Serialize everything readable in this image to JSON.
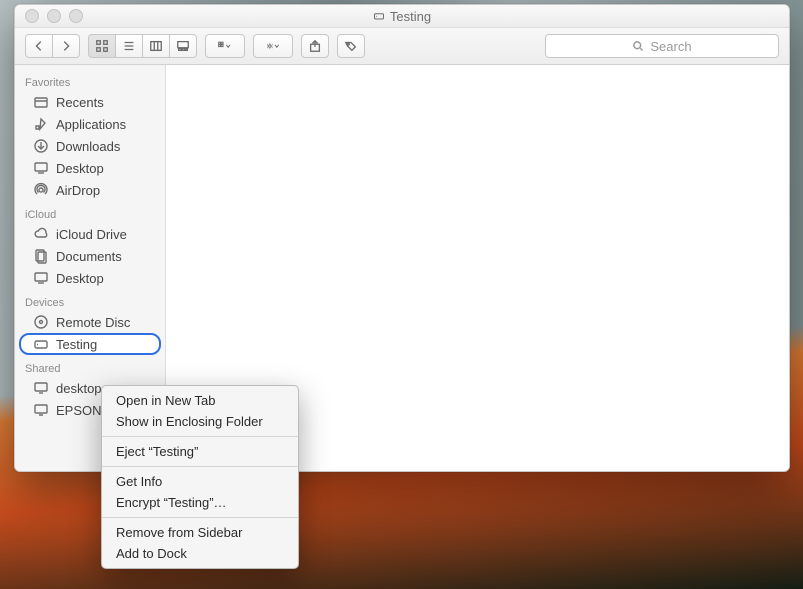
{
  "window": {
    "title": "Testing"
  },
  "toolbar": {
    "search_placeholder": "Search"
  },
  "sidebar": {
    "sections": [
      {
        "title": "Favorites",
        "items": [
          {
            "label": "Recents",
            "icon": "recents-icon"
          },
          {
            "label": "Applications",
            "icon": "applications-icon"
          },
          {
            "label": "Downloads",
            "icon": "downloads-icon"
          },
          {
            "label": "Desktop",
            "icon": "desktop-icon"
          },
          {
            "label": "AirDrop",
            "icon": "airdrop-icon"
          }
        ]
      },
      {
        "title": "iCloud",
        "items": [
          {
            "label": "iCloud Drive",
            "icon": "icloud-icon"
          },
          {
            "label": "Documents",
            "icon": "documents-icon"
          },
          {
            "label": "Desktop",
            "icon": "desktop-icon"
          }
        ]
      },
      {
        "title": "Devices",
        "items": [
          {
            "label": "Remote Disc",
            "icon": "remote-disc-icon"
          },
          {
            "label": "Testing",
            "icon": "disk-icon",
            "selected": true
          }
        ]
      },
      {
        "title": "Shared",
        "items": [
          {
            "label": "desktop",
            "icon": "display-icon"
          },
          {
            "label": "EPSON",
            "icon": "display-icon"
          }
        ]
      }
    ]
  },
  "context_menu": {
    "groups": [
      [
        "Open in New Tab",
        "Show in Enclosing Folder"
      ],
      [
        "Eject “Testing”"
      ],
      [
        "Get Info",
        "Encrypt “Testing”…"
      ],
      [
        "Remove from Sidebar",
        "Add to Dock"
      ]
    ]
  }
}
